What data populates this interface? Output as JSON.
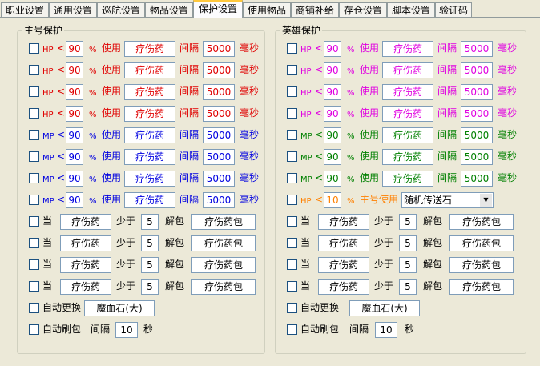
{
  "tabs": [
    "职业设置",
    "通用设置",
    "巡航设置",
    "物品设置",
    "保护设置",
    "使用物品",
    "商铺补给",
    "存仓设置",
    "脚本设置",
    "验证码"
  ],
  "active_tab": "保护设置",
  "colors": {
    "hp_main": "#e00000",
    "mp_main": "#0000e0",
    "hp_hero": "#e000e0",
    "mp_hero": "#008000",
    "hero_special": "#ff8000"
  },
  "left": {
    "title": "主号保护",
    "hp_rows": [
      {
        "stat": "HP",
        "lt": "<",
        "threshold": "90",
        "pct": "%",
        "use": "使用",
        "item": "疗伤药",
        "interval_label": "间隔",
        "interval": "5000",
        "unit": "毫秒"
      },
      {
        "stat": "HP",
        "lt": "<",
        "threshold": "90",
        "pct": "%",
        "use": "使用",
        "item": "疗伤药",
        "interval_label": "间隔",
        "interval": "5000",
        "unit": "毫秒"
      },
      {
        "stat": "HP",
        "lt": "<",
        "threshold": "90",
        "pct": "%",
        "use": "使用",
        "item": "疗伤药",
        "interval_label": "间隔",
        "interval": "5000",
        "unit": "毫秒"
      },
      {
        "stat": "HP",
        "lt": "<",
        "threshold": "90",
        "pct": "%",
        "use": "使用",
        "item": "疗伤药",
        "interval_label": "间隔",
        "interval": "5000",
        "unit": "毫秒"
      }
    ],
    "mp_rows": [
      {
        "stat": "MP",
        "lt": "<",
        "threshold": "90",
        "pct": "%",
        "use": "使用",
        "item": "疗伤药",
        "interval_label": "间隔",
        "interval": "5000",
        "unit": "毫秒"
      },
      {
        "stat": "MP",
        "lt": "<",
        "threshold": "90",
        "pct": "%",
        "use": "使用",
        "item": "疗伤药",
        "interval_label": "间隔",
        "interval": "5000",
        "unit": "毫秒"
      },
      {
        "stat": "MP",
        "lt": "<",
        "threshold": "90",
        "pct": "%",
        "use": "使用",
        "item": "疗伤药",
        "interval_label": "间隔",
        "interval": "5000",
        "unit": "毫秒"
      },
      {
        "stat": "MP",
        "lt": "<",
        "threshold": "90",
        "pct": "%",
        "use": "使用",
        "item": "疗伤药",
        "interval_label": "间隔",
        "interval": "5000",
        "unit": "毫秒"
      }
    ],
    "unpack_rows": [
      {
        "when": "当",
        "item": "疗伤药",
        "less": "少于",
        "count": "5",
        "unpack": "解包",
        "pack": "疗伤药包"
      },
      {
        "when": "当",
        "item": "疗伤药",
        "less": "少于",
        "count": "5",
        "unpack": "解包",
        "pack": "疗伤药包"
      },
      {
        "when": "当",
        "item": "疗伤药",
        "less": "少于",
        "count": "5",
        "unpack": "解包",
        "pack": "疗伤药包"
      },
      {
        "when": "当",
        "item": "疗伤药",
        "less": "少于",
        "count": "5",
        "unpack": "解包",
        "pack": "疗伤药包"
      }
    ],
    "auto_replace": {
      "label": "自动更换",
      "item": "魔血石(大)"
    },
    "auto_refresh": {
      "label": "自动刷包",
      "interval_label": "间隔",
      "interval": "10",
      "unit": "秒"
    }
  },
  "right": {
    "title": "英雄保护",
    "hp_rows": [
      {
        "stat": "HP",
        "lt": "<",
        "threshold": "90",
        "pct": "%",
        "use": "使用",
        "item": "疗伤药",
        "interval_label": "间隔",
        "interval": "5000",
        "unit": "毫秒"
      },
      {
        "stat": "HP",
        "lt": "<",
        "threshold": "90",
        "pct": "%",
        "use": "使用",
        "item": "疗伤药",
        "interval_label": "间隔",
        "interval": "5000",
        "unit": "毫秒"
      },
      {
        "stat": "HP",
        "lt": "<",
        "threshold": "90",
        "pct": "%",
        "use": "使用",
        "item": "疗伤药",
        "interval_label": "间隔",
        "interval": "5000",
        "unit": "毫秒"
      },
      {
        "stat": "HP",
        "lt": "<",
        "threshold": "90",
        "pct": "%",
        "use": "使用",
        "item": "疗伤药",
        "interval_label": "间隔",
        "interval": "5000",
        "unit": "毫秒"
      }
    ],
    "mp_rows": [
      {
        "stat": "MP",
        "lt": "<",
        "threshold": "90",
        "pct": "%",
        "use": "使用",
        "item": "疗伤药",
        "interval_label": "间隔",
        "interval": "5000",
        "unit": "毫秒"
      },
      {
        "stat": "MP",
        "lt": "<",
        "threshold": "90",
        "pct": "%",
        "use": "使用",
        "item": "疗伤药",
        "interval_label": "间隔",
        "interval": "5000",
        "unit": "毫秒"
      },
      {
        "stat": "MP",
        "lt": "<",
        "threshold": "90",
        "pct": "%",
        "use": "使用",
        "item": "疗伤药",
        "interval_label": "间隔",
        "interval": "5000",
        "unit": "毫秒"
      }
    ],
    "special_row": {
      "stat": "HP",
      "lt": "<",
      "threshold": "10",
      "pct": "%",
      "label": "主号使用",
      "select": "随机传送石"
    },
    "unpack_rows": [
      {
        "when": "当",
        "item": "疗伤药",
        "less": "少于",
        "count": "5",
        "unpack": "解包",
        "pack": "疗伤药包"
      },
      {
        "when": "当",
        "item": "疗伤药",
        "less": "少于",
        "count": "5",
        "unpack": "解包",
        "pack": "疗伤药包"
      },
      {
        "when": "当",
        "item": "疗伤药",
        "less": "少于",
        "count": "5",
        "unpack": "解包",
        "pack": "疗伤药包"
      },
      {
        "when": "当",
        "item": "疗伤药",
        "less": "少于",
        "count": "5",
        "unpack": "解包",
        "pack": "疗伤药包"
      }
    ],
    "auto_replace": {
      "label": "自动更换",
      "item": "魔血石(大)"
    },
    "auto_refresh": {
      "label": "自动刷包",
      "interval_label": "间隔",
      "interval": "10",
      "unit": "秒"
    }
  }
}
